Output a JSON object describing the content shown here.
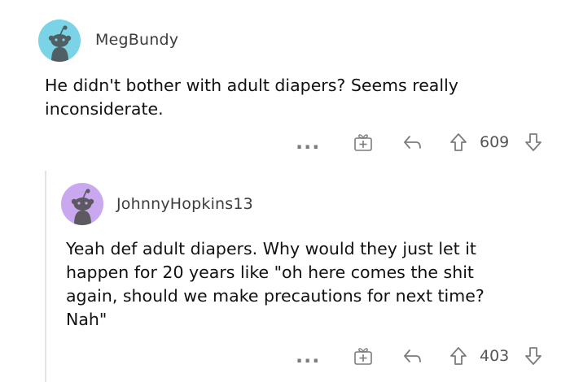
{
  "comments": [
    {
      "username": "MegBundy",
      "text_lines": [
        "He didn't bother with adult diapers?  Seems really",
        "inconsiderate."
      ],
      "more": "...",
      "score": "609",
      "avatar_bg": "#7ad3e6"
    },
    {
      "username": "JohnnyHopkins13",
      "text_lines": [
        "Yeah def adult diapers. Why would they just let it",
        "happen for 20 years like \"oh here comes the shit",
        "again, should we make precautions for next time?",
        "Nah\""
      ],
      "more": "...",
      "score": "403",
      "avatar_bg": "#c9a8ef"
    }
  ],
  "icons": {
    "award": "gift-award-icon",
    "reply": "reply-arrow-icon",
    "upvote": "upvote-arrow-icon",
    "downvote": "downvote-arrow-icon",
    "avatar": "snoo-avatar-icon"
  }
}
